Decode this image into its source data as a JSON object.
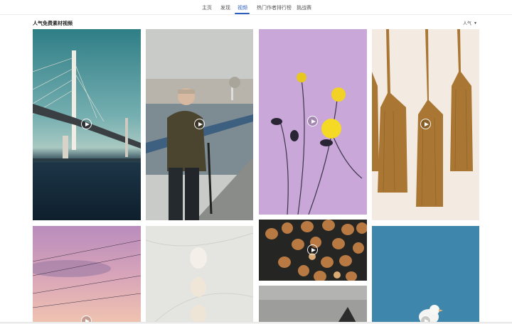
{
  "nav": {
    "items": [
      {
        "label": "主页"
      },
      {
        "label": "发现"
      },
      {
        "label": "视频"
      },
      {
        "label": "热门作者排行榜"
      },
      {
        "label": "挑战赛"
      }
    ],
    "active_index": 2,
    "active_color": "#2a5fbd"
  },
  "section": {
    "title": "人气免费素材视频",
    "sort_label": "人气"
  },
  "videos": [
    {
      "subject": "bridge",
      "play_icon": "play-icon"
    },
    {
      "subject": "old-man-waterfront",
      "play_icon": "play-icon"
    },
    {
      "subject": "yellow-flowers",
      "play_icon": "play-icon"
    },
    {
      "subject": "tassels",
      "play_icon": "play-icon"
    },
    {
      "subject": "pink-sky-powerlines",
      "play_icon": "play-icon"
    },
    {
      "subject": "eggs",
      "play_icon": "play-icon"
    },
    {
      "subject": "hazelnuts",
      "play_icon": "play-icon"
    },
    {
      "subject": "grey-texture",
      "play_icon": "none"
    },
    {
      "subject": "white-bird-blue-sky",
      "play_icon": "play-icon"
    }
  ]
}
